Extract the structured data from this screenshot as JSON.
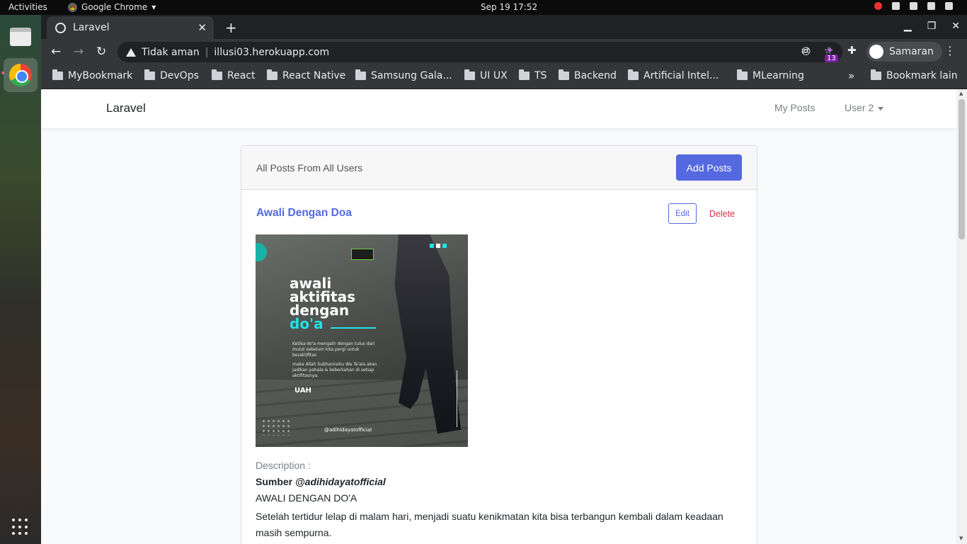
{
  "os": {
    "activities": "Activities",
    "app_name": "Google Chrome",
    "clock": "Sep 19  17:52"
  },
  "browser": {
    "tab_title": "Laravel",
    "security_label": "Tidak aman",
    "url": "illusi03.herokuapp.com",
    "extension_badge": "13",
    "profile_name": "Samaran",
    "bookmarks": [
      "MyBookmark",
      "DevOps",
      "React",
      "React Native",
      "Samsung Gala...",
      "UI UX",
      "TS",
      "Backend",
      "Artificial Intel...",
      "MLearning"
    ],
    "other_bookmarks": "Bookmark lain"
  },
  "page": {
    "brand": "Laravel",
    "nav": {
      "my_posts": "My Posts",
      "user": "User 2"
    },
    "card_header": "All Posts From All Users",
    "add_button": "Add Posts",
    "post": {
      "title": "Awali Dengan Doa",
      "edit_label": "Edit",
      "delete_label": "Delete",
      "poster": {
        "line1": "awali",
        "line2": "aktifitas",
        "line3": "dengan",
        "line4": "do'a",
        "text1": "Ketika do'a mengalir dengan tulus dari mulut sebelum kita pergi untuk beraktifitas",
        "text2": "maka Allah Subhannahu Wa Ta'ala akan jadikan pahala & keberkahan di setiap aktifitasnya.",
        "signature": "UAH",
        "handle": "@adihidayatofficial"
      },
      "description_label": "Description :",
      "source_prefix": "Sumber ",
      "source_handle": "@adihidayatofficial",
      "content_title": "AWALI DENGAN DO'A",
      "content_body": "Setelah tertidur lelap di malam hari, menjadi suatu kenikmatan kita bisa terbangun kembali dalam keadaan masih sempurna."
    }
  }
}
